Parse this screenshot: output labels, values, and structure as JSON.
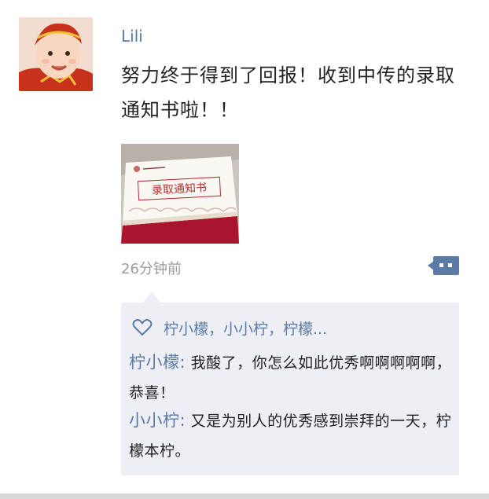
{
  "post": {
    "username": "Lili",
    "content": "努力终于得到了回报！收到中传的录取通知书啦！！",
    "photo_text": "录取通知书",
    "timestamp": "26分钟前"
  },
  "likes": {
    "names": "柠小檬，小小柠，柠檬..."
  },
  "comments": [
    {
      "author": "柠小檬:",
      "text": "我酸了，你怎么如此优秀啊啊啊啊啊，恭喜！"
    },
    {
      "author": "小小柠:",
      "text": "又是为别人的优秀感到崇拜的一天，柠檬本柠。"
    }
  ],
  "colors": {
    "accent": "#5b7aa6",
    "reply_bg": "#eeeef5",
    "text": "#222222",
    "muted": "#9a9a9a"
  }
}
